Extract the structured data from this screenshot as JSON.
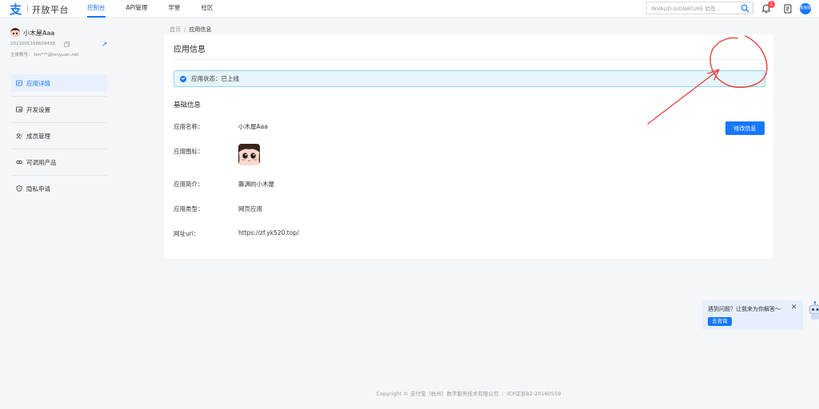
{
  "header": {
    "logo_text": "开放平台",
    "nav": [
      {
        "label": "控制台",
        "active": true
      },
      {
        "label": "API管理",
        "active": false
      },
      {
        "label": "学堂",
        "active": false
      },
      {
        "label": "社区",
        "active": false
      }
    ],
    "search_value": "INVALID-SIGNATURE 验签...",
    "notification_count": "1",
    "avatar_text": "极限版"
  },
  "sidebar": {
    "user_name": "小木屋Aaa",
    "user_id": "2021005168609438",
    "account_line": "主体账号： ten***@tenyuan.net",
    "items": [
      {
        "label": "应用详情",
        "active": true
      },
      {
        "label": "开发设置",
        "active": false
      },
      {
        "label": "成员管理",
        "active": false
      },
      {
        "label": "可调用产品",
        "active": false
      },
      {
        "label": "隐私申请",
        "active": false
      }
    ]
  },
  "breadcrumb": {
    "home": "首页",
    "sep": "/",
    "current": "应用信息"
  },
  "card": {
    "title": "应用信息",
    "status_text": "应用状态：已上线",
    "section_title": "基础信息",
    "edit_button": "修改信息",
    "fields": [
      {
        "label": "应用名称：",
        "value": "小木屋Aaa"
      },
      {
        "label": "应用图标：",
        "value": ""
      },
      {
        "label": "应用简介：",
        "value": "藤渊的小木屋"
      },
      {
        "label": "应用类型：",
        "value": "网页应用"
      },
      {
        "label": "网址url：",
        "value": "https://zf.yk520.top/"
      }
    ]
  },
  "help": {
    "text": "遇到问题？让我来为你解答～",
    "close": "✕",
    "button": "去咨询"
  },
  "footer": {
    "text": "Copyright © 支付宝（杭州）数字服务技术有限公司 ｜ ICP证浙B2-20160559"
  },
  "colors": {
    "accent": "#1677ff",
    "annotation": "#e8413b",
    "badge": "#ff4d4f"
  }
}
